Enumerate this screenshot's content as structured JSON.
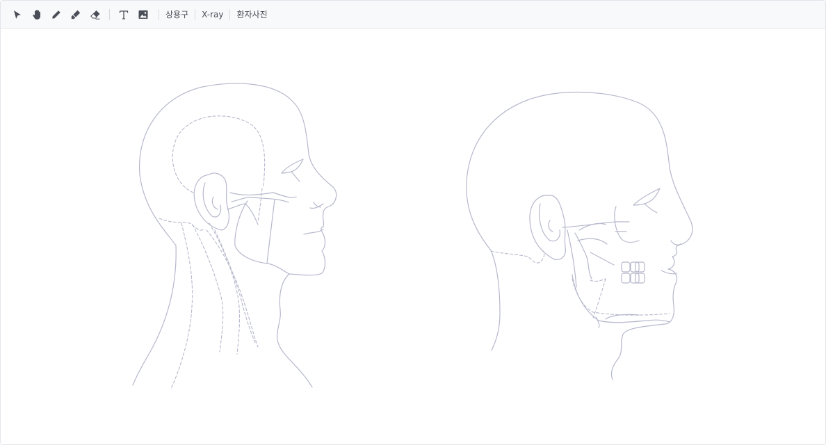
{
  "toolbar": {
    "tools": [
      {
        "id": "select",
        "icon": "cursor-arrow-icon"
      },
      {
        "id": "pan",
        "icon": "hand-icon"
      },
      {
        "id": "pen",
        "icon": "pencil-icon"
      },
      {
        "id": "highlighter",
        "icon": "marker-icon"
      },
      {
        "id": "eraser",
        "icon": "eraser-icon"
      },
      {
        "id": "text",
        "icon": "text-icon"
      },
      {
        "id": "image",
        "icon": "image-icon"
      }
    ],
    "phrases_label": "상용구",
    "xray_label": "X-ray",
    "patient_photo_label": "환자사진",
    "icon_color": "#4a4e57"
  },
  "canvas": {
    "background": "#ffffff",
    "line_color": "#b6b8cc",
    "figures": [
      "head-neck-lateral-diagram",
      "skull-jaw-lateral-diagram"
    ]
  }
}
